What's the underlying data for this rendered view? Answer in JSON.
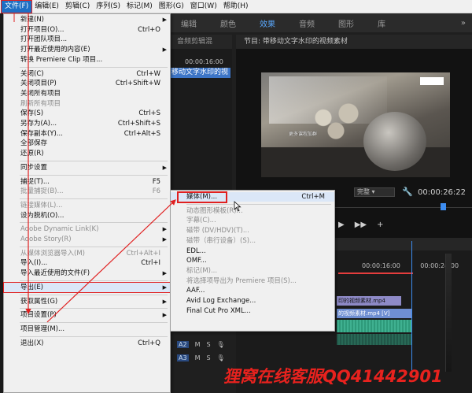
{
  "menubar": {
    "items": [
      {
        "label": "文件(F)",
        "active": true
      },
      {
        "label": "编辑(E)"
      },
      {
        "label": "剪辑(C)"
      },
      {
        "label": "序列(S)"
      },
      {
        "label": "标记(M)"
      },
      {
        "label": "图形(G)"
      },
      {
        "label": "窗口(W)"
      },
      {
        "label": "帮助(H)"
      }
    ]
  },
  "workspace_tabs": [
    "编辑",
    "颜色",
    "效果",
    "音频",
    "图形",
    "库"
  ],
  "workspace_active": "效果",
  "workspace_more": "»",
  "source_panel": {
    "title": "音频剪辑混",
    "time": "00:00:16:00",
    "clip": "移动文字水印的视"
  },
  "program_panel": {
    "title": "节目: 带移动文字水印的视频素材",
    "video_watermark": "更多课程加群",
    "fit": "完整",
    "timecode": "00:00:26:22"
  },
  "transport": [
    "▶",
    "▶▶",
    "+"
  ],
  "timeline": {
    "time_a": "00:00:16:00",
    "time_b": "00:00:24:00",
    "clip_v1": "印的视频素材.mp4",
    "clip_v2": "的视频素材.mp4 [V]",
    "tracks": [
      {
        "name": "A2",
        "m": "M",
        "s": "S"
      },
      {
        "name": "A3",
        "m": "M",
        "s": "S"
      }
    ]
  },
  "file_menu": {
    "items": [
      {
        "label": "新建(N)",
        "submenu": true
      },
      {
        "label": "打开项目(O)...",
        "shortcut": "Ctrl+O"
      },
      {
        "label": "打开团队项目..."
      },
      {
        "label": "打开最近使用的内容(E)",
        "submenu": true
      },
      {
        "label": "转换 Premiere Clip 项目..."
      },
      {
        "sep": true
      },
      {
        "label": "关闭(C)",
        "shortcut": "Ctrl+W"
      },
      {
        "label": "关闭项目(P)",
        "shortcut": "Ctrl+Shift+W"
      },
      {
        "label": "关闭所有项目"
      },
      {
        "label": "刷新所有项目",
        "disabled": true
      },
      {
        "label": "保存(S)",
        "shortcut": "Ctrl+S"
      },
      {
        "label": "另存为(A)...",
        "shortcut": "Ctrl+Shift+S"
      },
      {
        "label": "保存副本(Y)...",
        "shortcut": "Ctrl+Alt+S"
      },
      {
        "label": "全部保存"
      },
      {
        "label": "还原(R)"
      },
      {
        "sep": true
      },
      {
        "label": "同步设置",
        "submenu": true
      },
      {
        "sep": true
      },
      {
        "label": "捕捉(T)...",
        "shortcut": "F5"
      },
      {
        "label": "批量捕捉(B)...",
        "shortcut": "F6",
        "disabled": true
      },
      {
        "sep": true
      },
      {
        "label": "链接媒体(L)...",
        "disabled": true
      },
      {
        "label": "设为脱机(O)..."
      },
      {
        "sep": true
      },
      {
        "label": "Adobe Dynamic Link(K)",
        "submenu": true,
        "disabled": true
      },
      {
        "label": "Adobe Story(R)",
        "submenu": true,
        "disabled": true
      },
      {
        "sep": true
      },
      {
        "label": "从媒体浏览器导入(M)",
        "shortcut": "Ctrl+Alt+I",
        "disabled": true
      },
      {
        "label": "导入(I)...",
        "shortcut": "Ctrl+I"
      },
      {
        "label": "导入最近使用的文件(F)",
        "submenu": true
      },
      {
        "sep": true
      },
      {
        "label": "导出(E)",
        "submenu": true,
        "highlight": true
      },
      {
        "sep": true
      },
      {
        "label": "获取属性(G)",
        "submenu": true
      },
      {
        "sep": true
      },
      {
        "label": "项目设置(P)",
        "submenu": true
      },
      {
        "sep": true
      },
      {
        "label": "项目管理(M)..."
      },
      {
        "sep": true
      },
      {
        "label": "退出(X)",
        "shortcut": "Ctrl+Q"
      }
    ]
  },
  "export_menu": {
    "items": [
      {
        "label": "媒体(M)...",
        "shortcut": "Ctrl+M",
        "highlight": true
      },
      {
        "sep": true
      },
      {
        "label": "动态图形模板(R)...",
        "disabled": true
      },
      {
        "label": "字幕(C)...",
        "disabled": true
      },
      {
        "label": "磁带 (DV/HDV)(T)...",
        "disabled": true
      },
      {
        "label": "磁带（串行设备）(S)...",
        "disabled": true
      },
      {
        "label": "EDL..."
      },
      {
        "label": "OMF..."
      },
      {
        "label": "标记(M)...",
        "disabled": true
      },
      {
        "label": "将选择项导出为 Premiere 项目(S)...",
        "disabled": true
      },
      {
        "label": "AAF..."
      },
      {
        "label": "Avid Log Exchange..."
      },
      {
        "label": "Final Cut Pro XML..."
      }
    ]
  },
  "bottom_watermark": "狸窝在线客服QQ41442901",
  "colors": {
    "accent": "#1e6fc4",
    "annotation": "#e02020",
    "effects_tab": "#5aa9ff"
  }
}
